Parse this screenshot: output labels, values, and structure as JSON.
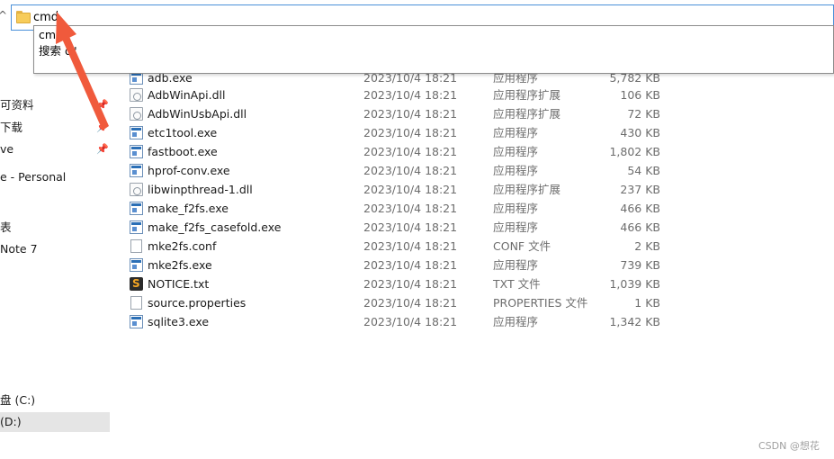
{
  "address_bar": {
    "value": "cmd"
  },
  "suggestions": [
    {
      "label": "cmd"
    },
    {
      "label": "搜索 \"cmd\"",
      "visible_text": "搜索          d\""
    }
  ],
  "nav": {
    "items": [
      {
        "label": "可资料",
        "pinned": true
      },
      {
        "label": "下载",
        "pinned": true
      },
      {
        "label": "ve",
        "pinned": true
      },
      {
        "label": "e - Personal",
        "pinned": false
      },
      {
        "label": "表",
        "pinned": false
      },
      {
        "label": "Note 7",
        "pinned": false
      },
      {
        "label": "盘 (C:)",
        "pinned": false
      },
      {
        "label": "(D:)",
        "pinned": false,
        "selected": true
      }
    ]
  },
  "files": [
    {
      "name": "adb.exe",
      "date": "2023/10/4 18:21",
      "type": "应用程序",
      "size": "5,782 KB",
      "icon": "exe-icon"
    },
    {
      "name": "AdbWinApi.dll",
      "date": "2023/10/4 18:21",
      "type": "应用程序扩展",
      "size": "106 KB",
      "icon": "dll-icon"
    },
    {
      "name": "AdbWinUsbApi.dll",
      "date": "2023/10/4 18:21",
      "type": "应用程序扩展",
      "size": "72 KB",
      "icon": "dll-icon"
    },
    {
      "name": "etc1tool.exe",
      "date": "2023/10/4 18:21",
      "type": "应用程序",
      "size": "430 KB",
      "icon": "exe-icon"
    },
    {
      "name": "fastboot.exe",
      "date": "2023/10/4 18:21",
      "type": "应用程序",
      "size": "1,802 KB",
      "icon": "exe-icon"
    },
    {
      "name": "hprof-conv.exe",
      "date": "2023/10/4 18:21",
      "type": "应用程序",
      "size": "54 KB",
      "icon": "exe-icon"
    },
    {
      "name": "libwinpthread-1.dll",
      "date": "2023/10/4 18:21",
      "type": "应用程序扩展",
      "size": "237 KB",
      "icon": "dll-icon"
    },
    {
      "name": "make_f2fs.exe",
      "date": "2023/10/4 18:21",
      "type": "应用程序",
      "size": "466 KB",
      "icon": "exe-icon"
    },
    {
      "name": "make_f2fs_casefold.exe",
      "date": "2023/10/4 18:21",
      "type": "应用程序",
      "size": "466 KB",
      "icon": "exe-icon"
    },
    {
      "name": "mke2fs.conf",
      "date": "2023/10/4 18:21",
      "type": "CONF 文件",
      "size": "2 KB",
      "icon": "file-icon"
    },
    {
      "name": "mke2fs.exe",
      "date": "2023/10/4 18:21",
      "type": "应用程序",
      "size": "739 KB",
      "icon": "exe-icon"
    },
    {
      "name": "NOTICE.txt",
      "date": "2023/10/4 18:21",
      "type": "TXT 文件",
      "size": "1,039 KB",
      "icon": "sublime-text-icon"
    },
    {
      "name": "source.properties",
      "date": "2023/10/4 18:21",
      "type": "PROPERTIES 文件",
      "size": "1 KB",
      "icon": "file-icon"
    },
    {
      "name": "sqlite3.exe",
      "date": "2023/10/4 18:21",
      "type": "应用程序",
      "size": "1,342 KB",
      "icon": "exe-icon"
    }
  ],
  "annotation": {
    "arrow_color": "#f05a3c"
  },
  "watermark": {
    "text": "CSDN @想花"
  }
}
